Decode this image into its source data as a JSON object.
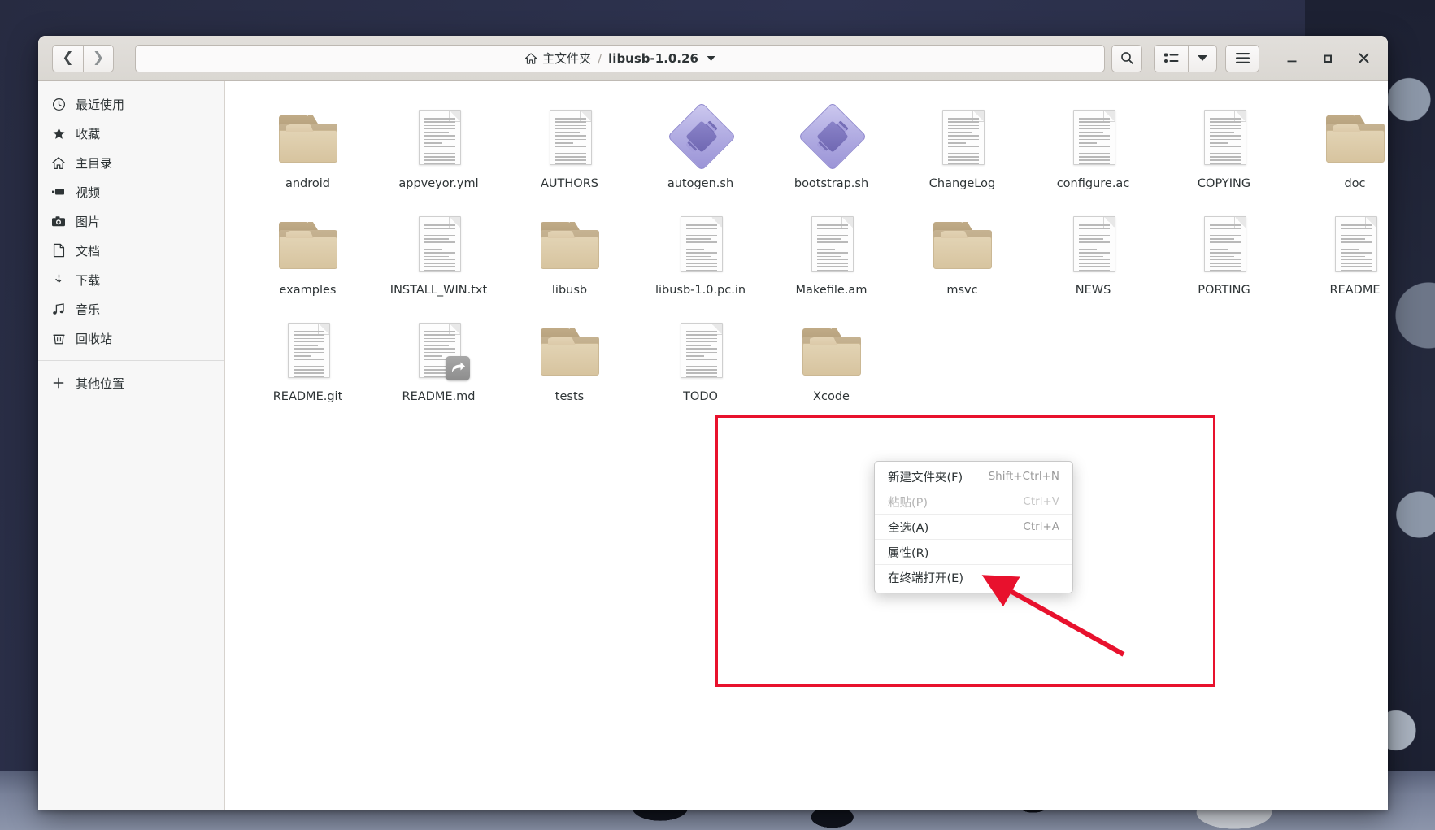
{
  "window": {
    "title": "libusb-1.0.26",
    "nav": {
      "back_icon": "chevron-left-icon",
      "forward_icon": "chevron-right-icon"
    },
    "pathbar": {
      "crumbs": [
        {
          "label": "主文件夹",
          "icon": "home-icon",
          "current": false
        },
        {
          "label": "libusb-1.0.26",
          "icon": "",
          "current": true
        }
      ],
      "separator": "/"
    },
    "search_button": {
      "icon": "search-icon",
      "label": ""
    },
    "view_toggle": {
      "icon": "list-view-icon",
      "label": ""
    },
    "view_dropdown": {
      "icon": "chevron-down-icon",
      "label": ""
    },
    "menu_button": {
      "icon": "hamburger-menu-icon",
      "label": ""
    },
    "controls": {
      "minimize": {
        "icon": "minimize-icon",
        "label": "_"
      },
      "maximize": {
        "icon": "maximize-icon",
        "label": "□"
      },
      "close": {
        "icon": "close-icon",
        "label": "✕"
      }
    }
  },
  "sidebar": {
    "items": [
      {
        "label": "最近使用",
        "icon": "clock-icon"
      },
      {
        "label": "收藏",
        "icon": "star-icon"
      },
      {
        "label": "主目录",
        "icon": "home-icon"
      },
      {
        "label": "视频",
        "icon": "video-icon"
      },
      {
        "label": "图片",
        "icon": "camera-icon"
      },
      {
        "label": "文档",
        "icon": "document-icon"
      },
      {
        "label": "下载",
        "icon": "download-icon"
      },
      {
        "label": "音乐",
        "icon": "music-note-icon"
      },
      {
        "label": "回收站",
        "icon": "trash-icon"
      }
    ],
    "other_locations": {
      "label": "其他位置",
      "icon": "plus-icon"
    }
  },
  "files": [
    {
      "name": "android",
      "type": "folder"
    },
    {
      "name": "appveyor.yml",
      "type": "document"
    },
    {
      "name": "AUTHORS",
      "type": "document"
    },
    {
      "name": "autogen.sh",
      "type": "script"
    },
    {
      "name": "bootstrap.sh",
      "type": "script"
    },
    {
      "name": "ChangeLog",
      "type": "document"
    },
    {
      "name": "configure.ac",
      "type": "document"
    },
    {
      "name": "COPYING",
      "type": "document"
    },
    {
      "name": "doc",
      "type": "folder"
    },
    {
      "name": "examples",
      "type": "folder"
    },
    {
      "name": "INSTALL_WIN.txt",
      "type": "document"
    },
    {
      "name": "libusb",
      "type": "folder"
    },
    {
      "name": "libusb-1.0.pc.in",
      "type": "document"
    },
    {
      "name": "Makefile.am",
      "type": "document"
    },
    {
      "name": "msvc",
      "type": "folder"
    },
    {
      "name": "NEWS",
      "type": "document"
    },
    {
      "name": "PORTING",
      "type": "document"
    },
    {
      "name": "README",
      "type": "document"
    },
    {
      "name": "README.git",
      "type": "document"
    },
    {
      "name": "README.md",
      "type": "document-symlink"
    },
    {
      "name": "tests",
      "type": "folder"
    },
    {
      "name": "TODO",
      "type": "document"
    },
    {
      "name": "Xcode",
      "type": "folder"
    }
  ],
  "context_menu": {
    "items": [
      {
        "label": "新建文件夹(F)",
        "accel": "Shift+Ctrl+N",
        "disabled": false
      },
      {
        "label": "粘贴(P)",
        "accel": "Ctrl+V",
        "disabled": true
      },
      {
        "label": "全选(A)",
        "accel": "Ctrl+A",
        "disabled": false
      },
      {
        "label": "属性(R)",
        "accel": "",
        "disabled": false
      },
      {
        "label": "在终端打开(E)",
        "accel": "",
        "disabled": false
      }
    ]
  },
  "annotation": {
    "box_color": "#e8112d",
    "arrow_color": "#e8112d"
  },
  "colors": {
    "folder": "#ddcba8",
    "headerbar": "#ded9d4",
    "sidebar": "#f7f7f7",
    "desktop": "#2a2e45"
  }
}
